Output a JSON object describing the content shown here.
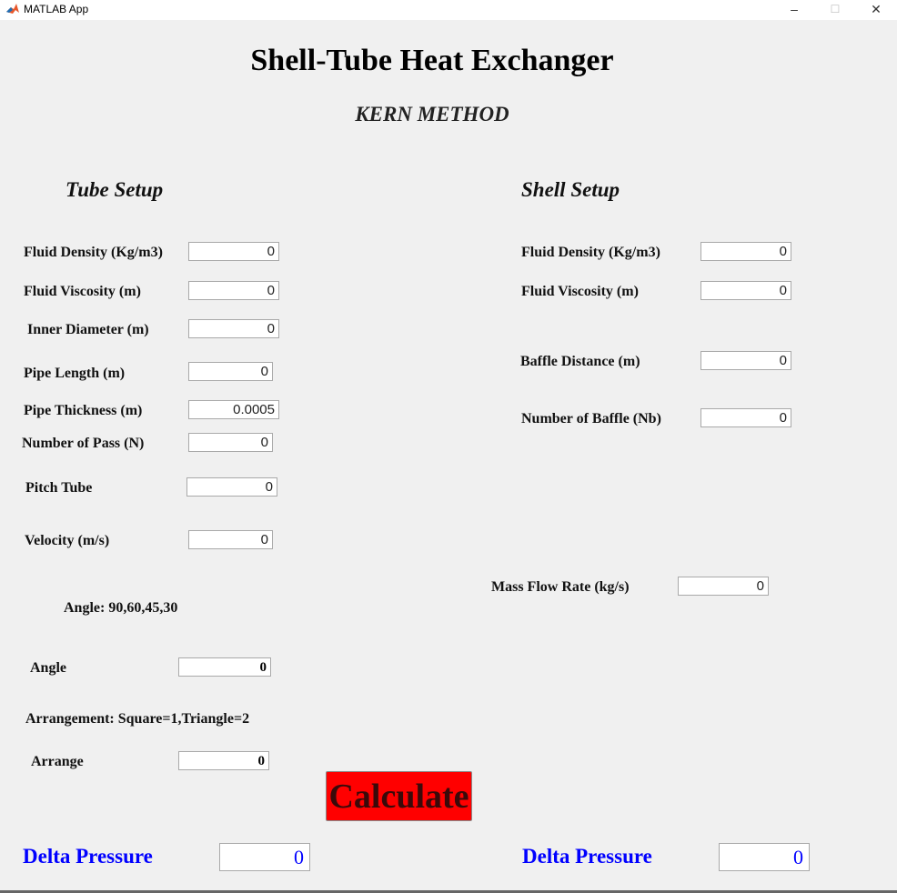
{
  "window": {
    "title": "MATLAB App",
    "minimize": "–",
    "maximize": "☐",
    "close": "✕"
  },
  "header": {
    "title": "Shell-Tube Heat Exchanger",
    "subtitle": "KERN METHOD"
  },
  "tube": {
    "section_title": "Tube Setup",
    "fields": [
      {
        "label": "Fluid Density (Kg/m3)",
        "value": "0"
      },
      {
        "label": "Fluid Viscosity (m)",
        "value": "0"
      },
      {
        "label": "Inner Diameter (m)",
        "value": "0"
      },
      {
        "label": "Pipe Length (m)",
        "value": "0"
      },
      {
        "label": "Pipe Thickness (m)",
        "value": "0.0005"
      },
      {
        "label": "Number of Pass (N)",
        "value": "0"
      },
      {
        "label": "Pitch Tube",
        "value": "0"
      },
      {
        "label": "Velocity (m/s)",
        "value": "0"
      }
    ],
    "angle_note": "Angle: 90,60,45,30",
    "angle": {
      "label": "Angle",
      "value": "0"
    },
    "arrangement_note": "Arrangement: Square=1,Triangle=2",
    "arrange": {
      "label": "Arrange",
      "value": "0"
    }
  },
  "shell": {
    "section_title": "Shell Setup",
    "fields": [
      {
        "label": "Fluid Density (Kg/m3)",
        "value": "0"
      },
      {
        "label": "Fluid Viscosity (m)",
        "value": "0"
      },
      {
        "label": "Baffle Distance (m)",
        "value": "0"
      },
      {
        "label": "Number of Baffle  (Nb)",
        "value": "0"
      }
    ],
    "mass_flow": {
      "label": "Mass Flow Rate (kg/s)",
      "value": "0"
    }
  },
  "actions": {
    "calculate_label": "Calculate"
  },
  "results": {
    "tube_delta_label": "Delta Pressure",
    "tube_delta_value": "0",
    "shell_delta_label": "Delta Pressure",
    "shell_delta_value": "0"
  },
  "colors": {
    "background": "#f0f0f0",
    "calculate_button": "#ff0000",
    "result_text": "#0000ff"
  }
}
